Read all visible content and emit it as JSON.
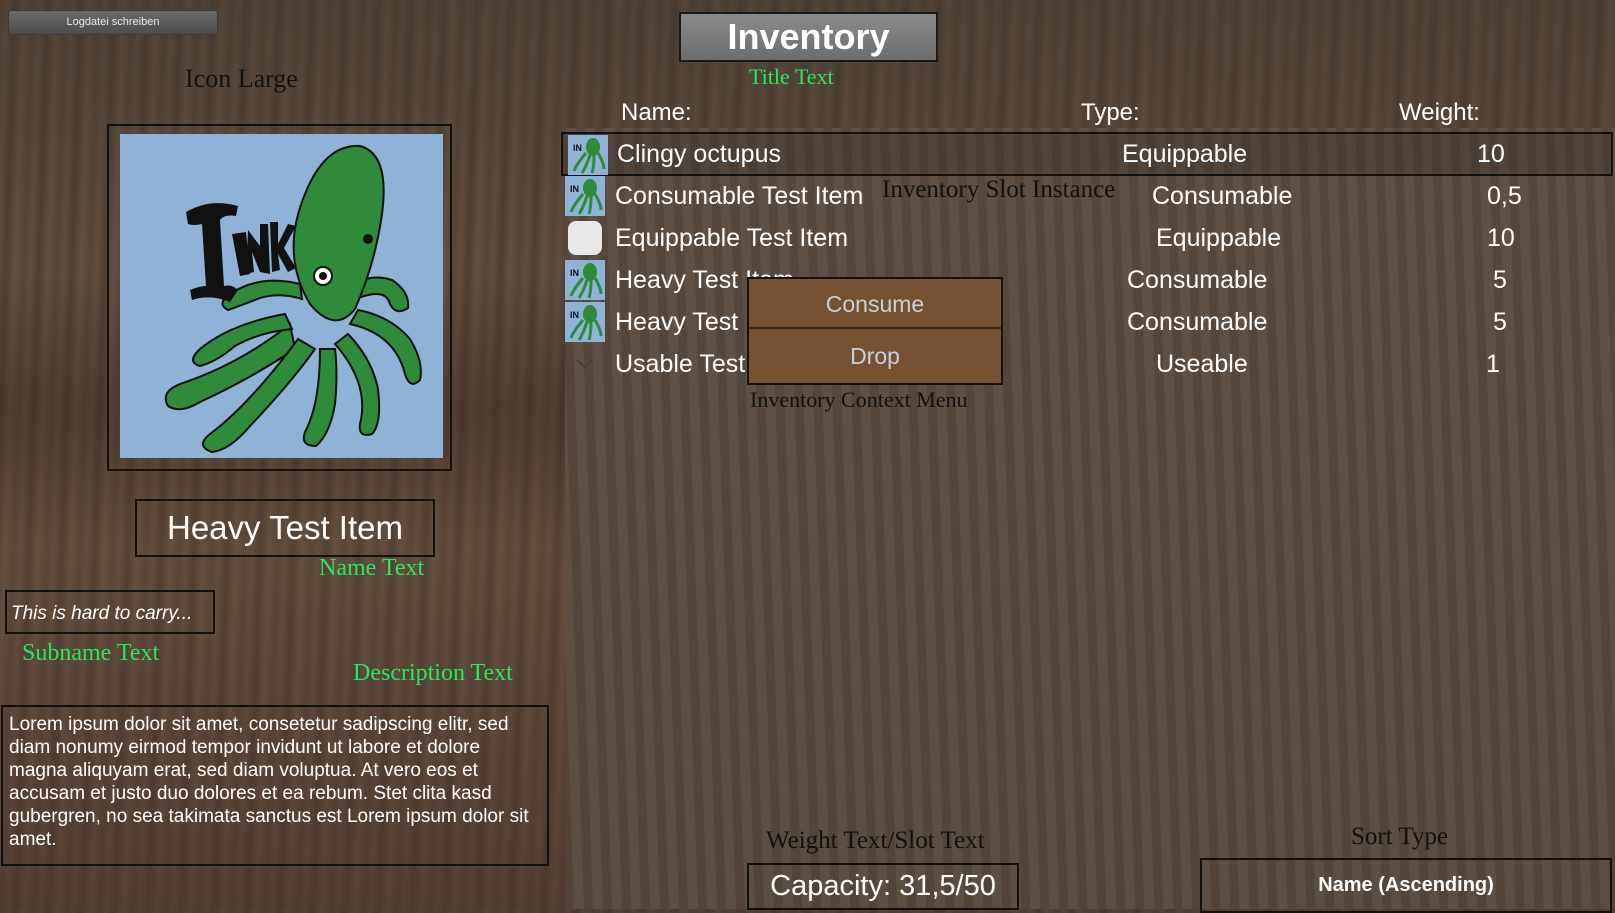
{
  "log_button": "Logdatei schreiben",
  "title": "Inventory",
  "labels": {
    "title_text": "Title Text",
    "icon_large": "Icon Large",
    "inventory_slot_instance": "Inventory Slot Instance",
    "inventory_context_menu": "Inventory Context Menu",
    "name_text": "Name Text",
    "subname_text": "Subname Text",
    "description_text": "Description Text",
    "weight_slot_text": "Weight Text/Slot Text",
    "sort_type": "Sort Type"
  },
  "columns": {
    "name": "Name:",
    "type": "Type:",
    "weight": "Weight:"
  },
  "items": [
    {
      "name": "Clingy octupus",
      "type": "Equippable",
      "weight": "10",
      "icon": "octopus-icon",
      "selected": true
    },
    {
      "name": "Consumable Test Item",
      "type": "Consumable",
      "weight": "0,5",
      "icon": "octopus-icon"
    },
    {
      "name": "Equippable Test Item",
      "type": "Equippable",
      "weight": "10",
      "icon": "blank-icon"
    },
    {
      "name": "Heavy Test Item",
      "type": "Consumable",
      "weight": "5",
      "icon": "octopus-icon"
    },
    {
      "name": "Heavy Test",
      "type": "Consumable",
      "weight": "5",
      "icon": "octopus-icon"
    },
    {
      "name": "Usable Test",
      "type": "Useable",
      "weight": "1",
      "icon": "chevron-down-icon"
    }
  ],
  "context_menu": {
    "consume": "Consume",
    "drop": "Drop"
  },
  "detail": {
    "name": "Heavy Test Item",
    "subname": "This is hard to carry...",
    "description": "Lorem ipsum dolor sit amet, consetetur sadipscing elitr, sed diam nonumy eirmod tempor invidunt ut labore et dolore magna aliquyam erat, sed diam voluptua. At vero eos et accusam et justo duo dolores et ea rebum. Stet clita kasd gubergren, no sea takimata sanctus est Lorem ipsum dolor sit amet.",
    "icon_logo_text": "INK"
  },
  "capacity": "Capacity: 31,5/50",
  "sort_value": "Name (Ascending)",
  "colors": {
    "label_green": "#26e85a",
    "context_bg": "#755232",
    "icon_bg": "#8fb3d6",
    "octopus_green": "#2f8a3a"
  }
}
